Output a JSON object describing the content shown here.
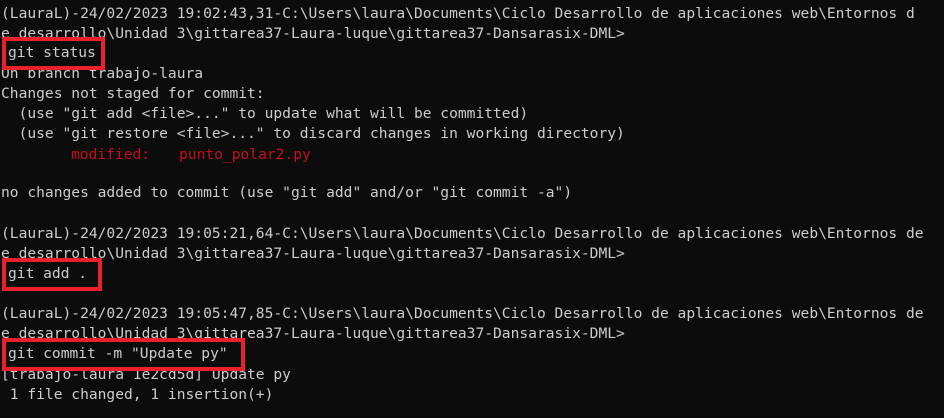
{
  "terminal": {
    "colors": {
      "background": "#0c0c0c",
      "foreground": "#cccccc",
      "modified": "#c50f1f",
      "highlight_box": "#e8212a"
    },
    "block1": {
      "prompt_line1": "(LauraL)-24/02/2023 19:02:43,31-C:\\Users\\laura\\Documents\\Ciclo Desarrollo de aplicaciones web\\Entornos d",
      "prompt_line2": "e desarrollo\\Unidad 3\\gittarea37-Laura-luque\\gittarea37-Dansarasix-DML>",
      "command": "git status",
      "output": [
        "On branch trabajo-laura",
        "Changes not staged for commit:",
        "  (use \"git add <file>...\" to update what will be committed)",
        "  (use \"git restore <file>...\" to discard changes in working directory)"
      ],
      "modified_label": "modified:",
      "modified_file": "punto_polar2.py",
      "summary": "no changes added to commit (use \"git add\" and/or \"git commit -a\")"
    },
    "block2": {
      "prompt_line1": "(LauraL)-24/02/2023 19:05:21,64-C:\\Users\\laura\\Documents\\Ciclo Desarrollo de aplicaciones web\\Entornos de",
      "prompt_line2": "e desarrollo\\Unidad 3\\gittarea37-Laura-luque\\gittarea37-Dansarasix-DML>",
      "command": "git add ."
    },
    "block3": {
      "prompt_line1": "(LauraL)-24/02/2023 19:05:47,85-C:\\Users\\laura\\Documents\\Ciclo Desarrollo de aplicaciones web\\Entornos de",
      "prompt_line2": "e desarrollo\\Unidad 3\\gittarea37-Laura-luque\\gittarea37-Dansarasix-DML>",
      "command": "git commit -m \"Update py\"",
      "output": [
        "[trabajo-laura 1e2cd5d] Update py",
        " 1 file changed, 1 insertion(+)"
      ]
    }
  }
}
